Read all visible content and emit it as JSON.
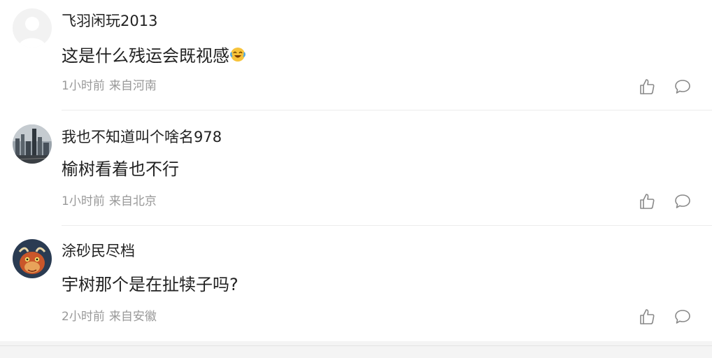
{
  "comments": [
    {
      "username": "飞羽闲玩2013",
      "content": "这是什么残运会既视感",
      "emoji": "laughing-crying-emoji",
      "time": "1小时前",
      "location": "来自河南",
      "avatar": "default-avatar"
    },
    {
      "username": "我也不知道叫个啥名978",
      "content": "榆树看着也不行",
      "time": "1小时前",
      "location": "来自北京",
      "avatar": "city-skyline-avatar"
    },
    {
      "username": "涂砂民尽档",
      "content": "宇树那个是在扯犊子吗?",
      "time": "2小时前",
      "location": "来自安徽",
      "avatar": "dragon-avatar"
    }
  ],
  "icons": {
    "like": "thumbs-up-icon",
    "reply": "speech-bubble-icon"
  },
  "colors": {
    "text": "#222222",
    "meta": "#999999",
    "icon": "#888888",
    "divider": "#ececec"
  }
}
